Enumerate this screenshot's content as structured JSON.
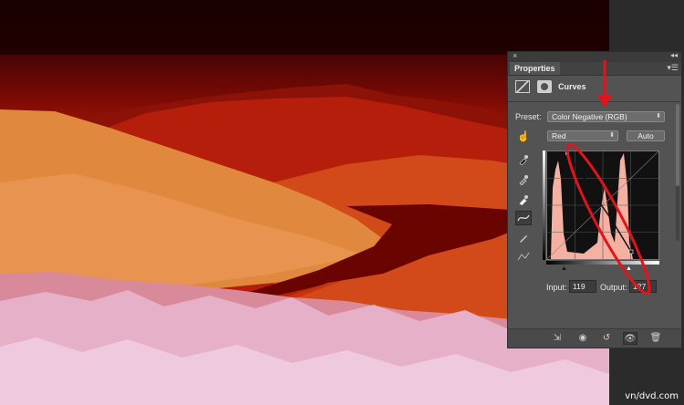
{
  "panel": {
    "close_glyph": "×",
    "collapse_glyph": "◂◂",
    "tab_label": "Properties",
    "menu_glyph": "▾☰",
    "title": "Curves",
    "preset_label": "Preset:",
    "preset_value": "Color Negative (RGB)",
    "channel_value": "Red",
    "auto_label": "Auto",
    "input_label": "Input:",
    "input_value": "119",
    "output_label": "Output:",
    "output_value": "127",
    "icons": [
      "curves-adjustment-icon",
      "mask-icon",
      "targeted-adjustment-hand-icon",
      "black-point-eyedropper-icon",
      "gray-point-eyedropper-icon",
      "white-point-eyedropper-icon",
      "curve-point-tool-icon",
      "pencil-draw-icon",
      "smooth-curve-icon",
      "clip-to-layer-icon",
      "view-previous-state-icon",
      "reset-icon",
      "visibility-eye-icon",
      "trash-icon"
    ]
  },
  "annotation": {
    "arrow_color": "#e0141a",
    "ellipse_color": "#e0141a"
  },
  "watermark": "vn/dvd.com",
  "colors": {
    "panel_bg": "#535353",
    "histogram_fill": "#f4b0a0"
  }
}
